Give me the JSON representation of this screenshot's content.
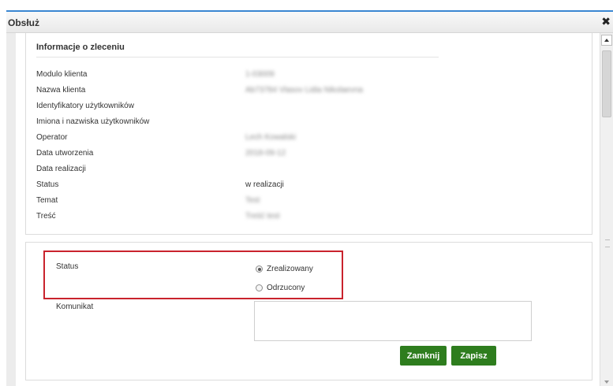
{
  "dialog": {
    "title": "Obsłuż",
    "close_glyph": "✖"
  },
  "info": {
    "title": "Informacje o zleceniu",
    "rows": [
      {
        "label": "Modulo klienta",
        "value": "1-03009",
        "blurred": true
      },
      {
        "label": "Nazwa klienta",
        "value": "Ab73784 Vlasov Lidia Nikolaevna",
        "blurred": true
      },
      {
        "label": "Identyfikatory użytkowników",
        "value": "",
        "blurred": false
      },
      {
        "label": "Imiona i nazwiska użytkowników",
        "value": "",
        "blurred": false
      },
      {
        "label": "Operator",
        "value": "Lech Kowalski",
        "blurred": true
      },
      {
        "label": "Data utworzenia",
        "value": "2018-09-12",
        "blurred": true
      },
      {
        "label": "Data realizacji",
        "value": "",
        "blurred": false
      },
      {
        "label": "Status",
        "value": "w realizacji",
        "blurred": false
      },
      {
        "label": "Temat",
        "value": "Test",
        "blurred": true
      },
      {
        "label": "Treść",
        "value": "Treść test",
        "blurred": true
      }
    ]
  },
  "form": {
    "status_label": "Status",
    "options": [
      {
        "label": "Zrealizowany",
        "selected": true
      },
      {
        "label": "Odrzucony",
        "selected": false
      }
    ],
    "message_label": "Komunikat",
    "message_value": "",
    "close_button": "Zamknij",
    "save_button": "Zapisz"
  },
  "colors": {
    "accent_border": "#3a87d2",
    "highlight": "#c9232d",
    "button": "#2e7d1e"
  }
}
